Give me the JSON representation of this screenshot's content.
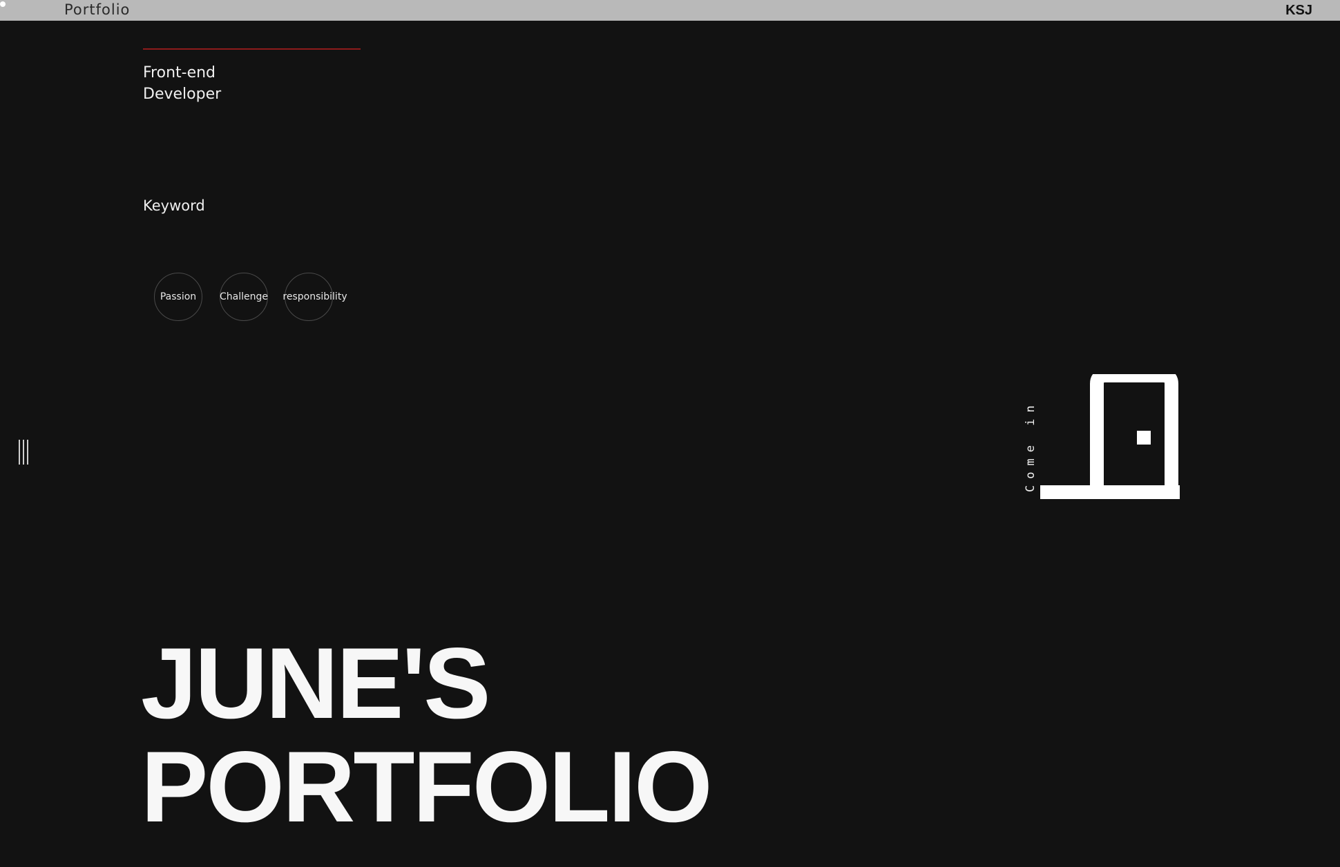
{
  "header": {
    "brand": "Portfolio",
    "initials": "KSJ"
  },
  "intro": {
    "role_line_1": "Front-end",
    "role_line_2": "Developer",
    "keyword_title": "Keyword",
    "keywords": [
      "Passion",
      "Challenge",
      "responsibility"
    ]
  },
  "entrance": {
    "label": "Come in",
    "icon": "door-icon"
  },
  "hero": {
    "line_1": "JUNE'S",
    "line_2": "PORTFOLIO"
  },
  "colors": {
    "background": "#121212",
    "topbar": "#b9b9b9",
    "accent_line": "#8f1b1b",
    "text": "#f2f2f2"
  }
}
